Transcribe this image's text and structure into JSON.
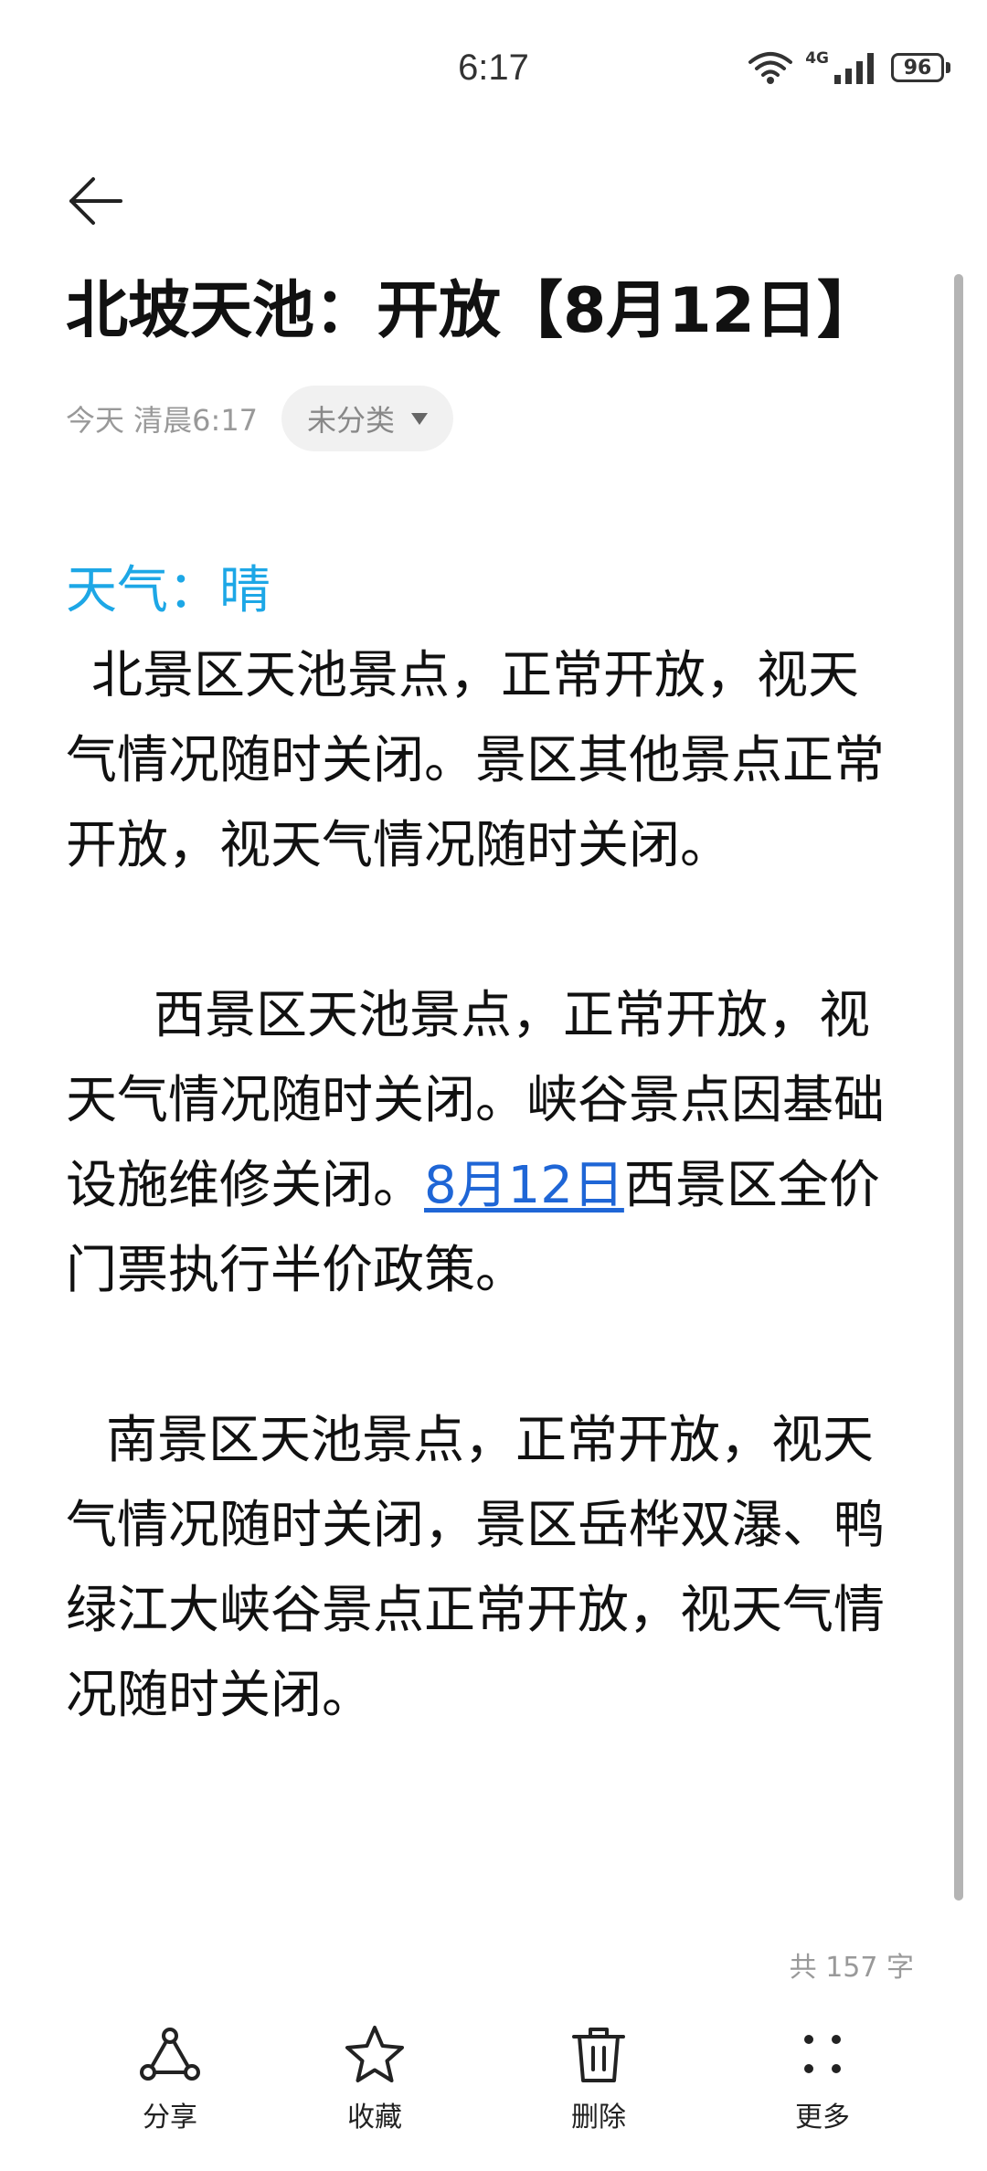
{
  "status_bar": {
    "time": "6:17",
    "network_label": "4G",
    "battery_level": "96"
  },
  "note": {
    "title": "北坡天池：开放【8月12日】",
    "date": "今天 清晨6:17",
    "category": "未分类",
    "weather": "天气：晴",
    "paragraph1": "北景区天池景点，正常开放，视天气情况随时关闭。景区其他景点正常开放，视天气情况随时关闭。",
    "paragraph2_before": "西景区天池景点，正常开放，视天气情况随时关闭。峡谷景点因基础设施维修关闭。",
    "paragraph2_link": "8月12日",
    "paragraph2_after": "西景区全价门票执行半价政策。",
    "paragraph3": "南景区天池景点，正常开放，视天气情况随时关闭，景区岳桦双瀑、鸭绿江大峡谷景点正常开放，视天气情况随时关闭。",
    "word_count": "共 157 字"
  },
  "toolbar": {
    "share_label": "分享",
    "favorite_label": "收藏",
    "delete_label": "删除",
    "more_label": "更多"
  },
  "icons": [
    "back-arrow-icon",
    "wifi-icon",
    "signal-icon",
    "battery-icon",
    "chevron-down-icon",
    "share-icon",
    "star-icon",
    "trash-icon",
    "more-icon"
  ],
  "colors": {
    "weather_text": "#1da7e6",
    "link": "#1f66d6",
    "secondary_text": "#999999",
    "chip_background": "#f1f1f1"
  }
}
